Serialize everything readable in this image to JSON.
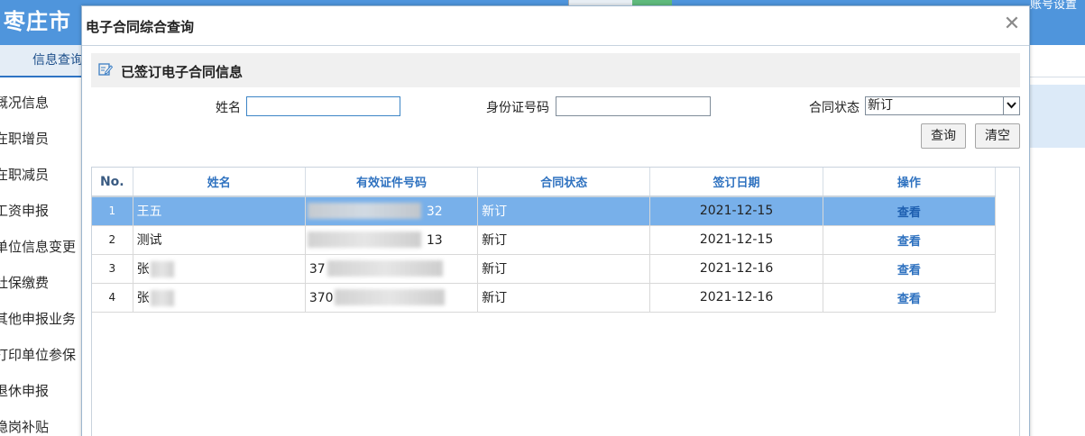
{
  "background": {
    "app_title": "枣庄市",
    "top_right_text": "账号设置",
    "active_tab": "信息查询",
    "left_menu": [
      "概况信息",
      "在职增员",
      "在职减员",
      "工资申报",
      "单位信息变更",
      "社保缴费",
      "其他申报业务",
      "打印单位参保",
      "退休申报",
      "稳岗补贴"
    ]
  },
  "dialog": {
    "title": "电子合同综合查询",
    "close_glyph": "✕",
    "section_title": "已签订电子合同信息",
    "section_icon": "edit-icon",
    "form": {
      "name_label": "姓名",
      "name_value": "",
      "id_label": "身份证号码",
      "id_value": "",
      "status_label": "合同状态",
      "status_value": "新订",
      "search_button": "查询",
      "clear_button": "清空"
    },
    "table": {
      "headers": [
        "No.",
        "姓名",
        "有效证件号码",
        "合同状态",
        "签订日期",
        "操作"
      ],
      "rows": [
        {
          "no": "1",
          "name": "王五",
          "id_visible": "32",
          "status": "新订",
          "date": "2021-12-15",
          "action": "查看"
        },
        {
          "no": "2",
          "name": "测试",
          "id_visible": "13",
          "status": "新订",
          "date": "2021-12-15",
          "action": "查看"
        },
        {
          "no": "3",
          "name": "张",
          "id_visible": "37",
          "status": "新订",
          "date": "2021-12-16",
          "action": "查看"
        },
        {
          "no": "4",
          "name": "张",
          "id_visible": "370",
          "status": "新订",
          "date": "2021-12-16",
          "action": "查看"
        }
      ]
    }
  }
}
